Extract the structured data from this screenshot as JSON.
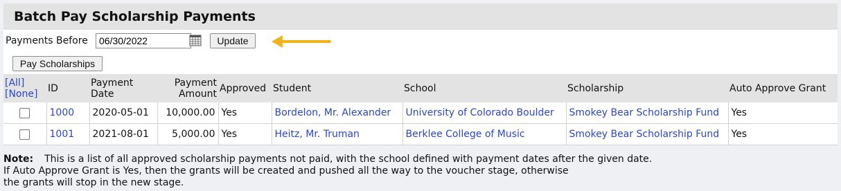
{
  "title": "Batch Pay Scholarship Payments",
  "filter": {
    "label": "Payments Before",
    "date_value": "06/30/2022",
    "update_label": "Update"
  },
  "actions": {
    "pay_label": "Pay Scholarships"
  },
  "table": {
    "select_all": "[All]",
    "select_none": "[None]",
    "headers": {
      "id": "ID",
      "payment_date": "Payment Date",
      "payment_amount": "Payment Amount",
      "approved": "Approved",
      "student": "Student",
      "school": "School",
      "scholarship": "Scholarship",
      "auto_approve": "Auto Approve Grant"
    },
    "rows": [
      {
        "id": "1000",
        "date": "2020-05-01",
        "amount": "10,000.00",
        "approved": "Yes",
        "student": "Bordelon, Mr. Alexander",
        "school": "University of Colorado Boulder",
        "scholarship": "Smokey Bear Scholarship Fund",
        "auto_approve": "Yes"
      },
      {
        "id": "1001",
        "date": "2021-08-01",
        "amount": "5,000.00",
        "approved": "Yes",
        "student": "Heitz, Mr. Truman",
        "school": "Berklee College of Music",
        "scholarship": "Smokey Bear Scholarship Fund",
        "auto_approve": "Yes"
      }
    ]
  },
  "note": {
    "label": "Note:",
    "line1": "This is a list of all approved scholarship payments not paid, with the school defined with payment dates after the given date.",
    "line2": "If Auto Approve Grant is Yes, then the grants will be created and pushed all the way to the voucher stage, otherwise",
    "line3": "the grants will stop in the new stage."
  },
  "colors": {
    "link": "#2a47c4",
    "header_bg": "#e3e3e3",
    "arrow": "#f2b21c"
  },
  "icons": [
    "calendar-icon",
    "arrow-pointer-icon",
    "checkbox"
  ]
}
